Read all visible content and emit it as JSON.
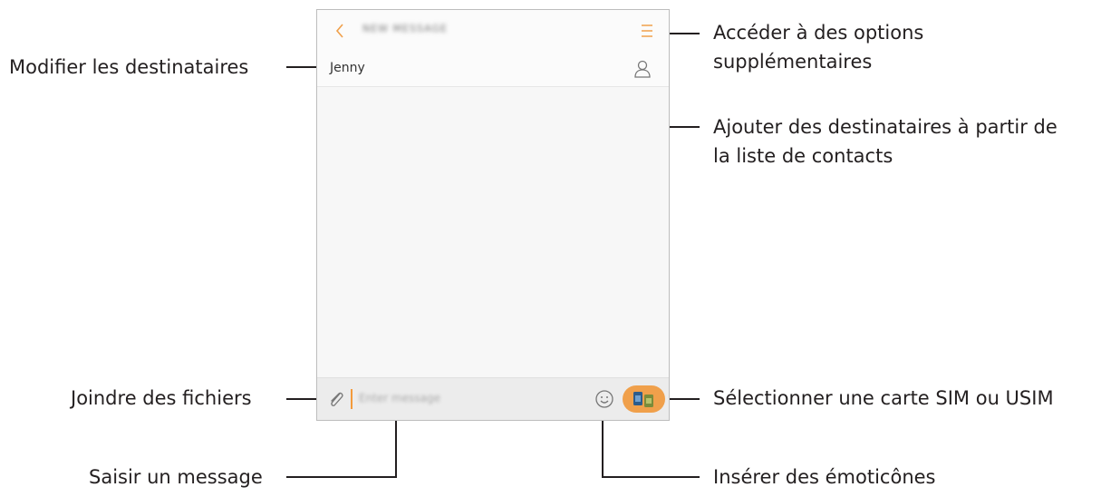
{
  "phone": {
    "header": {
      "back_icon": "chevron-left-icon",
      "title": "NEW MESSAGE",
      "menu_icon": "menu-icon"
    },
    "recipient": {
      "name": "Jenny",
      "contact_icon": "contact-icon"
    },
    "compose": {
      "attach_icon": "paperclip-icon",
      "placeholder": "Enter message",
      "emoji_icon": "smiley-icon",
      "send_icon": "sim-card-icon"
    },
    "accent_color": "#f0a04b"
  },
  "callouts": {
    "modify_recipients": "Modifier les destinataires",
    "more_options_line1": "Accéder à des options",
    "more_options_line2": "supplémentaires",
    "add_contacts_line1": "Ajouter des destinataires à partir de",
    "add_contacts_line2": "la liste de contacts",
    "attach_files": "Joindre des fichiers",
    "select_sim": "Sélectionner une carte SIM ou USIM",
    "enter_message": "Saisir un message",
    "insert_emoticons": "Insérer des émoticônes"
  }
}
